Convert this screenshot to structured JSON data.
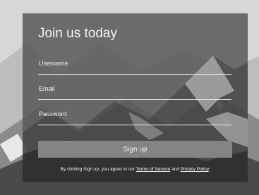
{
  "form": {
    "title": "Join us today",
    "username_placeholder": "Username",
    "email_placeholder": "Email",
    "password_placeholder": "Password",
    "submit_label": "Sign up"
  },
  "terms": {
    "prefix": "By clicking Sign up, you agree to our",
    "tos_label": "Terms of Service",
    "and": "and",
    "privacy_label": "Privacy Policy",
    "suffix": "."
  }
}
